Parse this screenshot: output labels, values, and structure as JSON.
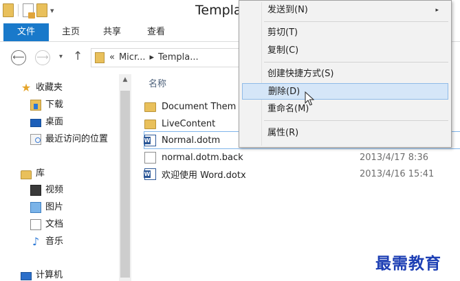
{
  "window": {
    "title": "Templa"
  },
  "quick_access": {
    "dropdown_glyph": "▾"
  },
  "ribbon": {
    "tabs": [
      {
        "label": "文件",
        "active": true
      },
      {
        "label": "主页"
      },
      {
        "label": "共享"
      },
      {
        "label": "查看"
      }
    ],
    "accent": "#1979ca"
  },
  "address": {
    "back": "⟵",
    "forward": "⟶",
    "up": "↑",
    "dropdown": "▾",
    "crumbs": [
      "«",
      "Micr...",
      "▸",
      "Templa..."
    ]
  },
  "nav": {
    "items": [
      {
        "label": "收藏夹",
        "icon": "star-icon"
      },
      {
        "label": "下载",
        "icon": "download-folder-icon"
      },
      {
        "label": "桌面",
        "icon": "desktop-icon"
      },
      {
        "label": "最近访问的位置",
        "icon": "recent-places-icon"
      },
      {
        "label": "库",
        "icon": "library-icon"
      },
      {
        "label": "视频",
        "icon": "video-icon"
      },
      {
        "label": "图片",
        "icon": "pictures-icon"
      },
      {
        "label": "文档",
        "icon": "documents-icon"
      },
      {
        "label": "音乐",
        "icon": "music-icon"
      },
      {
        "label": "计算机",
        "icon": "computer-icon"
      }
    ]
  },
  "list": {
    "column_name": "名称",
    "files": [
      {
        "name": "Document Them",
        "date": "",
        "icon": "folder-icon"
      },
      {
        "name": "LiveContent",
        "date": "",
        "icon": "folder-icon"
      },
      {
        "name": "Normal.dotm",
        "date": "",
        "icon": "word-template-icon",
        "selected": true
      },
      {
        "name": "normal.dotm.back",
        "date": "2013/4/17 8:36",
        "icon": "file-icon"
      },
      {
        "name": "欢迎使用 Word.dotx",
        "date": "2013/4/16 15:41",
        "icon": "word-template-icon"
      }
    ]
  },
  "context_menu": {
    "items": [
      {
        "label": "发送到(N)",
        "submenu": "▸"
      },
      {
        "label": "剪切(T)"
      },
      {
        "label": "复制(C)"
      },
      {
        "label": "创建快捷方式(S)"
      },
      {
        "label": "删除(D)",
        "highlighted": true
      },
      {
        "label": "重命名(M)"
      },
      {
        "label": "属性(R)"
      }
    ]
  },
  "watermark": {
    "text": "最需教育"
  }
}
